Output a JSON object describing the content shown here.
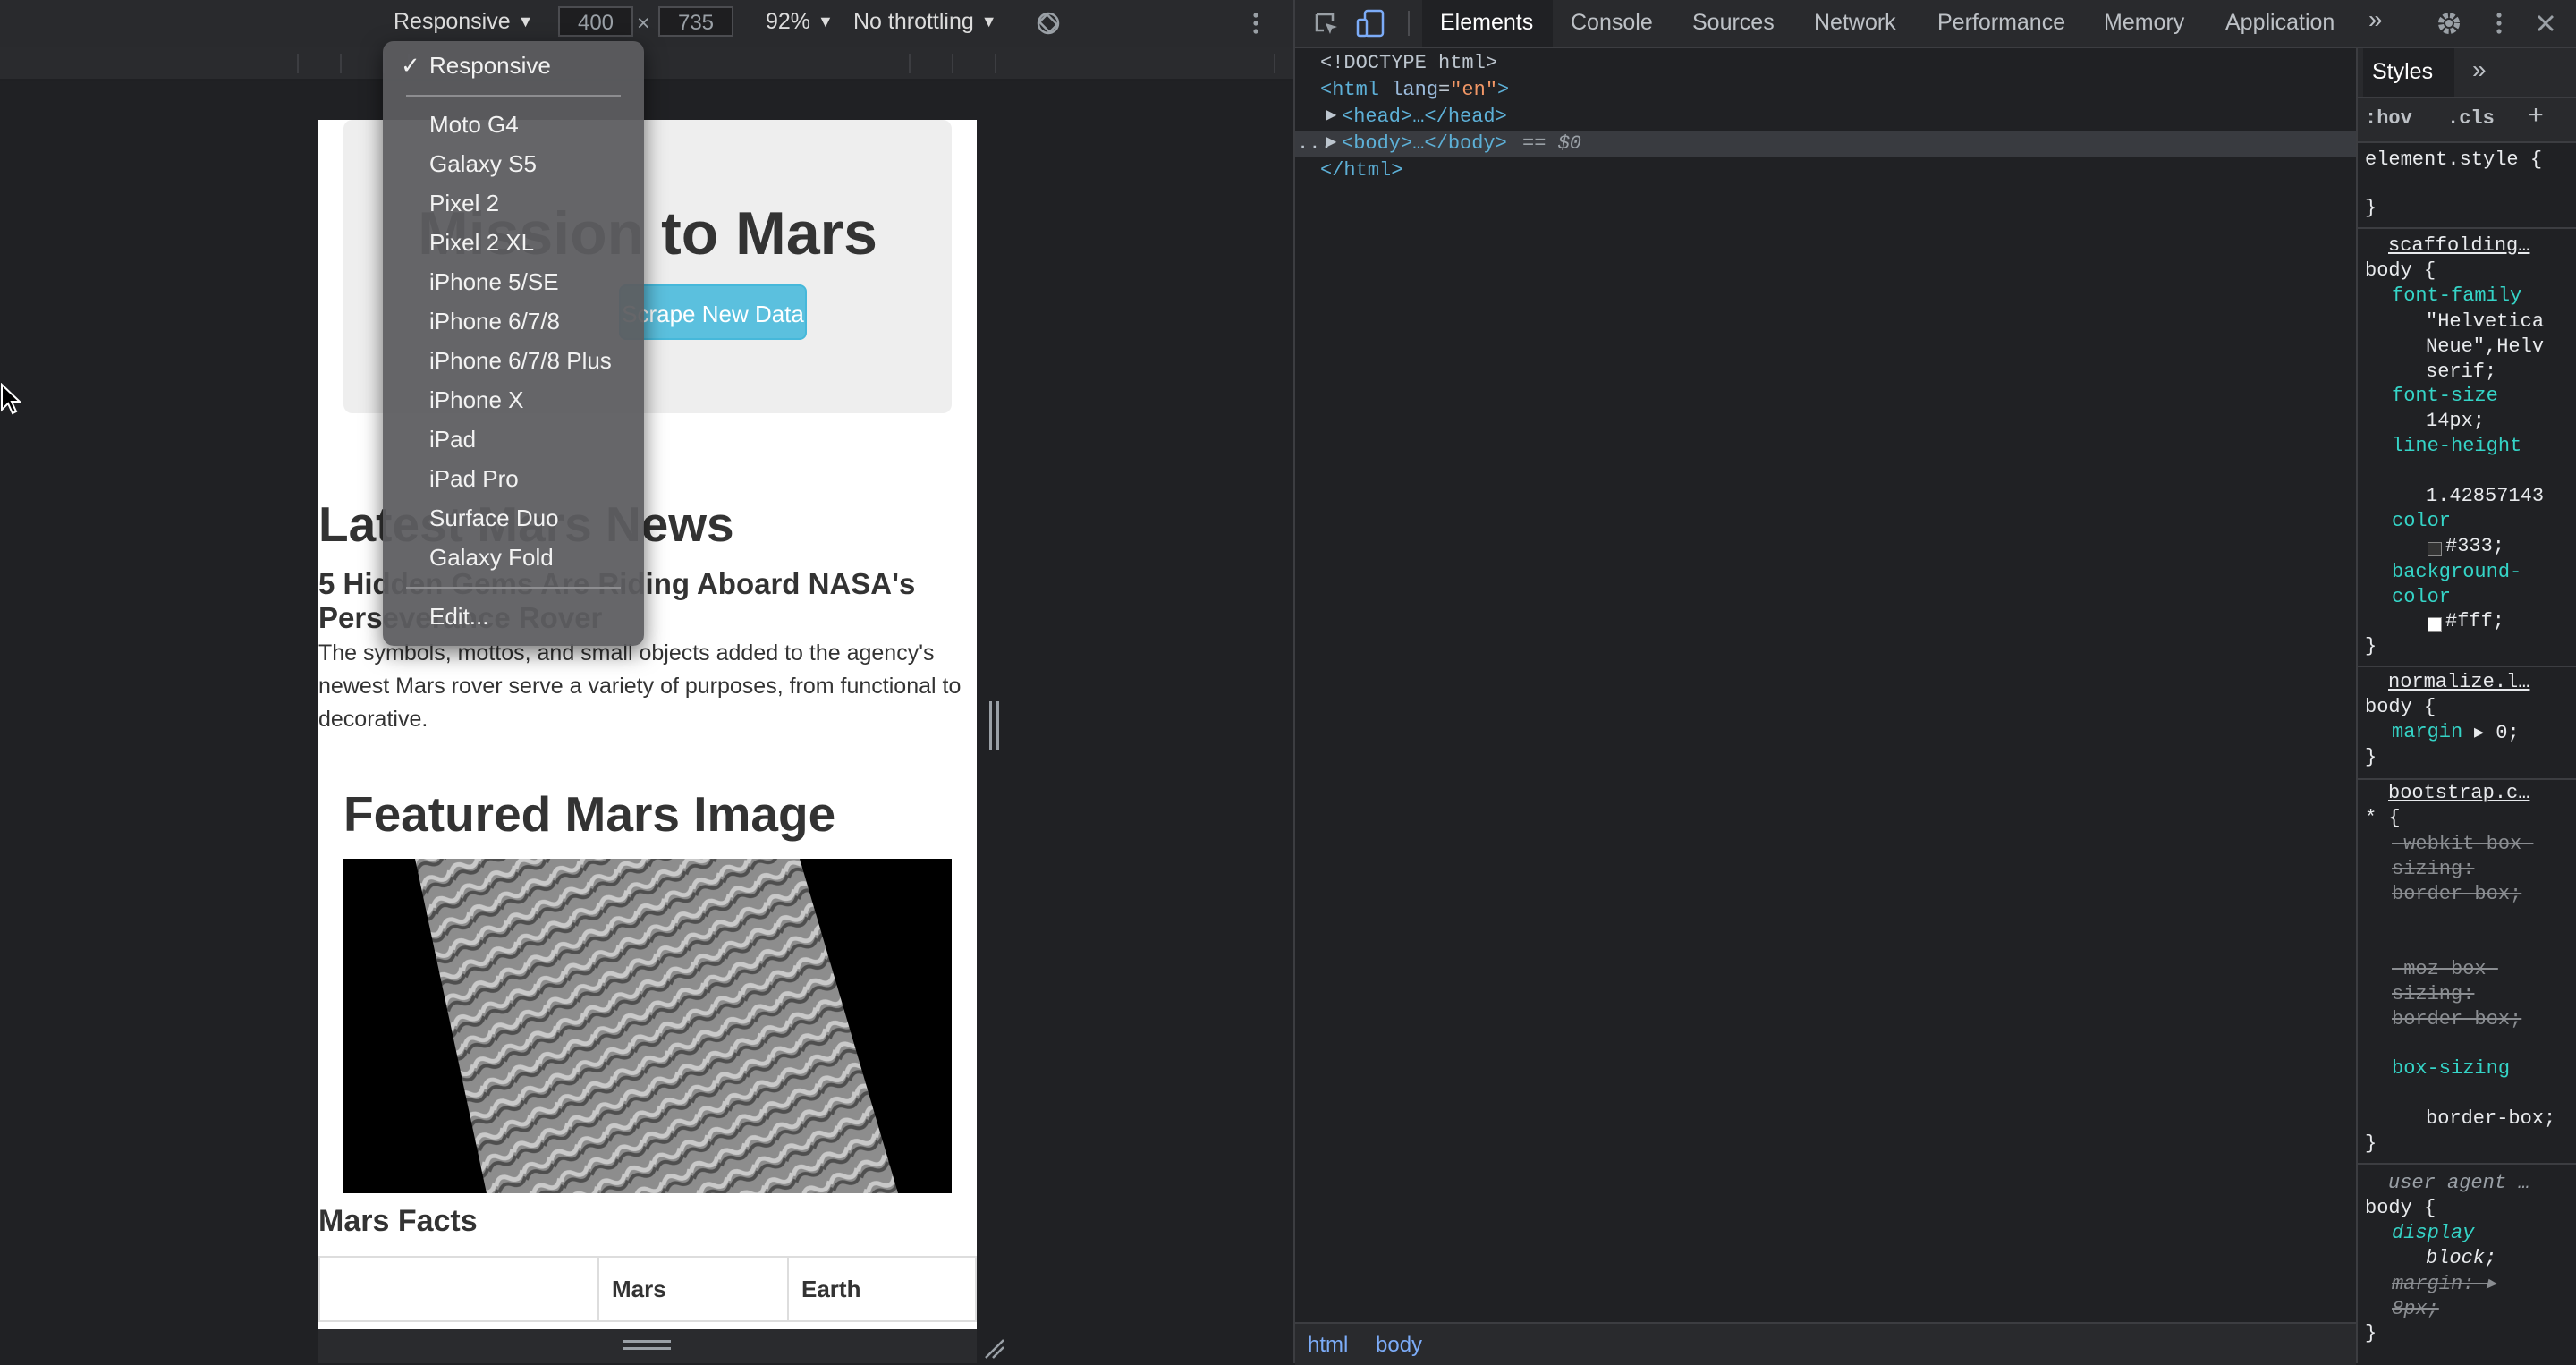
{
  "toolbar": {
    "device_select": "Responsive",
    "width_value": "400",
    "times": "×",
    "height_value": "735",
    "zoom": "92%",
    "throttle": "No throttling"
  },
  "device_menu": {
    "selected_check": "✓",
    "items": [
      "Responsive",
      "Moto G4",
      "Galaxy S5",
      "Pixel 2",
      "Pixel 2 XL",
      "iPhone 5/SE",
      "iPhone 6/7/8",
      "iPhone 6/7/8 Plus",
      "iPhone X",
      "iPad",
      "iPad Pro",
      "Surface Duo",
      "Galaxy Fold",
      "Edit..."
    ]
  },
  "page": {
    "jumbo_title": "Mission to Mars",
    "scrape_button": "Scrape New Data",
    "news_heading": "Latest Mars News",
    "news_title": "5 Hidden Gems Are Riding Aboard NASA's Perseverance Rover",
    "news_teaser": "The symbols, mottos, and small objects added to the agency's newest Mars rover serve a variety of purposes, from functional to decorative.",
    "featured_heading": "Featured Mars Image",
    "facts_heading": "Mars Facts",
    "facts_columns": [
      "",
      "Mars",
      "Earth"
    ]
  },
  "devtools": {
    "tabs": [
      "Elements",
      "Console",
      "Sources",
      "Network",
      "Performance",
      "Memory",
      "Application"
    ],
    "more": "»",
    "dom": {
      "doctype": "<!DOCTYPE html>",
      "html_open": "<html",
      "html_attr": "lang",
      "html_val": "\"en\"",
      "head": "<head>…</head>",
      "body": "<body>…</body>",
      "selected_marker": "== $0",
      "html_close": "</html>",
      "dots": "..."
    },
    "styles": {
      "tab": "Styles",
      "more": "»",
      "hov": ":hov",
      "cls": ".cls",
      "plus": "+",
      "element_style": "element.style {",
      "close_brace": "}",
      "src1": "scaffolding…",
      "sel1": "body {",
      "p_font_family": "font-family",
      "v_font_family": "\"Helvetica Neue\",Helv serif;",
      "p_font_size": "font-size",
      "v_font_size": "14px;",
      "p_line_height": "line-height",
      "v_line_height": "1.42857143",
      "p_color": "color",
      "v_color": "#333;",
      "p_bg": "background-color",
      "v_bg": "#fff;",
      "src2": "normalize.l…",
      "sel2": "body {",
      "p_margin": "margin",
      "v_margin": "▸ 0;",
      "src3": "bootstrap.c…",
      "sel3": "* {",
      "p_webkit": "-webkit-box-sizing: border-box;",
      "p_moz": "-moz-box-sizing: border-box;",
      "p_boxsizing": "box-sizing",
      "v_boxsizing": "border-box;",
      "src4": "user agent …",
      "sel4": "body {",
      "p_display": "display",
      "v_display": "block;",
      "p_ua_margin": "margin: ▸ 8px;"
    },
    "breadcrumbs": [
      "html",
      "body"
    ]
  },
  "colors": {
    "accent": "#5bc0de",
    "toolbar_bg": "#292a2d",
    "panel_bg": "#202124"
  }
}
